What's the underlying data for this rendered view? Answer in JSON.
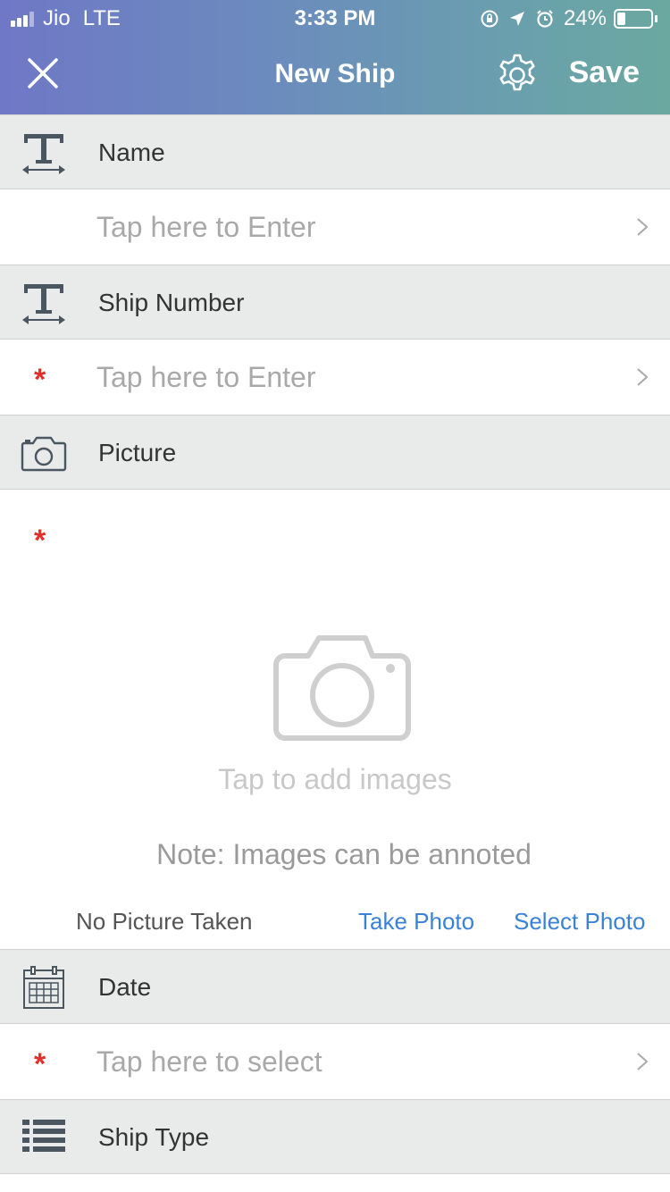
{
  "status_bar": {
    "carrier": "Jio",
    "network": "LTE",
    "time": "3:33 PM",
    "battery": "24%",
    "battery_level": 0.24,
    "icons": [
      "signal-icon",
      "orientation-lock-icon",
      "location-icon",
      "alarm-icon",
      "battery-icon"
    ]
  },
  "nav": {
    "title": "New Ship",
    "save_label": "Save",
    "close_icon": "close-icon",
    "settings_icon": "gear-icon"
  },
  "sections": {
    "name": {
      "label": "Name",
      "icon": "text-field-icon",
      "placeholder": "Tap here to Enter",
      "required": false
    },
    "ship_number": {
      "label": "Ship Number",
      "icon": "text-field-icon",
      "placeholder": "Tap here to Enter",
      "required": true,
      "required_mark": "*"
    },
    "picture": {
      "label": "Picture",
      "icon": "camera-icon",
      "required_mark": "*",
      "tap_to_add": "Tap to add images",
      "note": "Note: Images can be annoted",
      "status": "No Picture Taken",
      "take_photo": "Take Photo",
      "select_photo": "Select Photo"
    },
    "date": {
      "label": "Date",
      "icon": "calendar-icon",
      "placeholder": "Tap here to select",
      "required": true,
      "required_mark": "*"
    },
    "ship_type": {
      "label": "Ship Type",
      "icon": "list-icon"
    }
  },
  "colors": {
    "header_gradient_start": "#6f78c6",
    "header_gradient_end": "#6ba8a0",
    "section_bg": "#e9eaea",
    "required": "#e0302b",
    "link": "#3b82d6",
    "placeholder": "#a9a9a9",
    "icon": "#4a5660"
  }
}
